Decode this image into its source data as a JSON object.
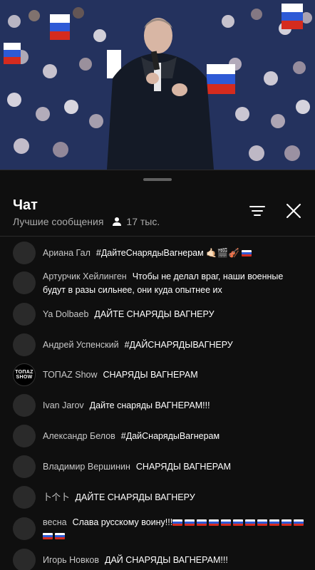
{
  "video": {
    "description_icon": "video-frame-speaker-at-rally"
  },
  "chat": {
    "title": "Чат",
    "mode": "Лучшие сообщения",
    "viewers": "17 тыс.",
    "filter_icon": "filter-icon",
    "close_icon": "close-icon"
  },
  "messages": [
    {
      "author": "Ариана Гал",
      "text": "#ДайтеСнарядыВагнерам 🤙🏻🎬🎻",
      "flags": 1
    },
    {
      "author": "Артурчик Хейлинген",
      "text": "Чтобы не делал враг, наши военные будут в разы сильнее, они куда опытнее их",
      "flags": 0
    },
    {
      "author": "Ya Dolbaeb",
      "text": "ДАЙТЕ СНАРЯДЫ ВАГНЕРУ",
      "flags": 0
    },
    {
      "author": "Андрей Успенский",
      "text": "#ДАЙСНАРЯДЫВАГНЕРУ",
      "flags": 0
    },
    {
      "author": "ТОПАZ Show",
      "text": "СНАРЯДЫ ВАГНЕРАМ",
      "flags": 0,
      "avatar_text": "ТОПАZ\nSHOW"
    },
    {
      "author": "Ivan Jarov",
      "text": "Дайте снаряды ВАГНЕРАМ!!!",
      "flags": 0
    },
    {
      "author": "Александр Белов",
      "text": "#ДайСнарядыВагнерам",
      "flags": 0
    },
    {
      "author": "Владимир Вершинин",
      "text": "СНАРЯДЫ ВАГНЕРАМ",
      "flags": 0
    },
    {
      "author": "卜个卜",
      "text": "ДАЙТЕ СНАРЯДЫ ВАГНЕРУ",
      "flags": 0
    },
    {
      "author": "весна",
      "text": "Слава русскому воину!!!",
      "flags": 13
    },
    {
      "author": "Игорь Новков",
      "text": "ДАЙ СНАРЯДЫ ВАГНЕРАМ!!!",
      "flags": 0
    }
  ]
}
